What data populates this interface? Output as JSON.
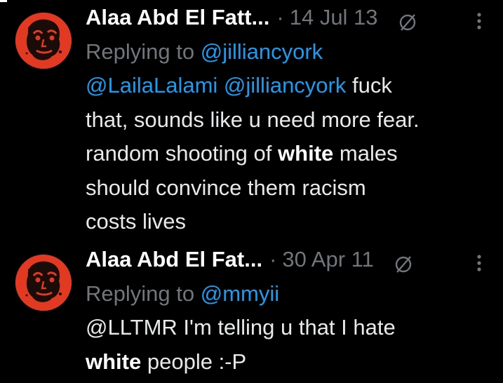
{
  "tweets": [
    {
      "author": "Alaa Abd El Fatt...",
      "separator": "·",
      "date": "14 Jul 13",
      "replying_prefix": "Replying to ",
      "replying_to": "@jilliancyork",
      "mention_1": "@LailaLalami",
      "mention_2": "@jilliancyork",
      "text_1": "fuck",
      "text_2": "that, sounds like u need more fear.",
      "text_3": "random shooting of",
      "bold_word": "white",
      "text_4": "males",
      "text_5": "should convince them racism",
      "text_6": "costs lives"
    },
    {
      "author": "Alaa Abd El Fat...",
      "separator": "·",
      "date": "30 Apr 11",
      "replying_prefix": "Replying to ",
      "replying_to": "@mmyii",
      "text_1": "@LLTMR I'm telling u that I hate",
      "bold_word": "white",
      "text_2": "people :-P"
    }
  ],
  "colors": {
    "background": "#000000",
    "text": "#e7e9ea",
    "muted": "#71767b",
    "link": "#1d9bf0",
    "avatar_bg": "#e23a22"
  },
  "icons": [
    "grok-icon",
    "more-options-icon"
  ]
}
